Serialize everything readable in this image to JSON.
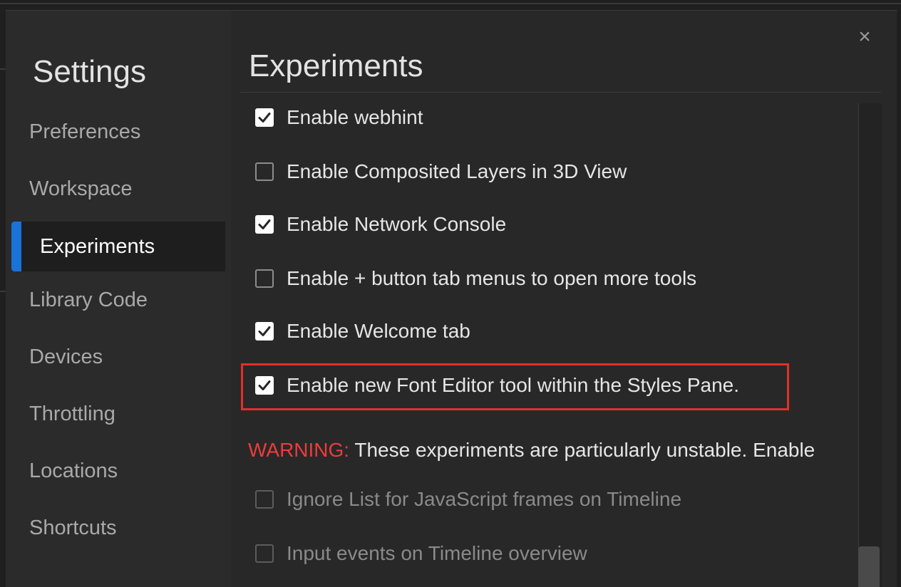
{
  "sidebar": {
    "title": "Settings",
    "items": [
      {
        "label": "Preferences"
      },
      {
        "label": "Workspace"
      },
      {
        "label": "Experiments"
      },
      {
        "label": "Library Code"
      },
      {
        "label": "Devices"
      },
      {
        "label": "Throttling"
      },
      {
        "label": "Locations"
      },
      {
        "label": "Shortcuts"
      }
    ],
    "active_item": "Experiments"
  },
  "main": {
    "title": "Experiments",
    "close_label": "×",
    "experiments": [
      {
        "label": "Enable webhint",
        "checked": true
      },
      {
        "label": "Enable Composited Layers in 3D View",
        "checked": false
      },
      {
        "label": "Enable Network Console",
        "checked": true
      },
      {
        "label": "Enable + button tab menus to open more tools",
        "checked": false
      },
      {
        "label": "Enable Welcome tab",
        "checked": true
      },
      {
        "label": "Enable new Font Editor tool within the Styles Pane.",
        "checked": true,
        "highlighted": true
      }
    ],
    "warning": {
      "prefix": "WARNING:",
      "text": " These experiments are particularly unstable. Enable"
    },
    "unstable_experiments": [
      {
        "label": "Ignore List for JavaScript frames on Timeline",
        "checked": false
      },
      {
        "label": "Input events on Timeline overview",
        "checked": false
      }
    ]
  },
  "colors": {
    "accent": "#1a73d9",
    "warning": "#ef3b3b",
    "highlight": "#e2302a"
  }
}
